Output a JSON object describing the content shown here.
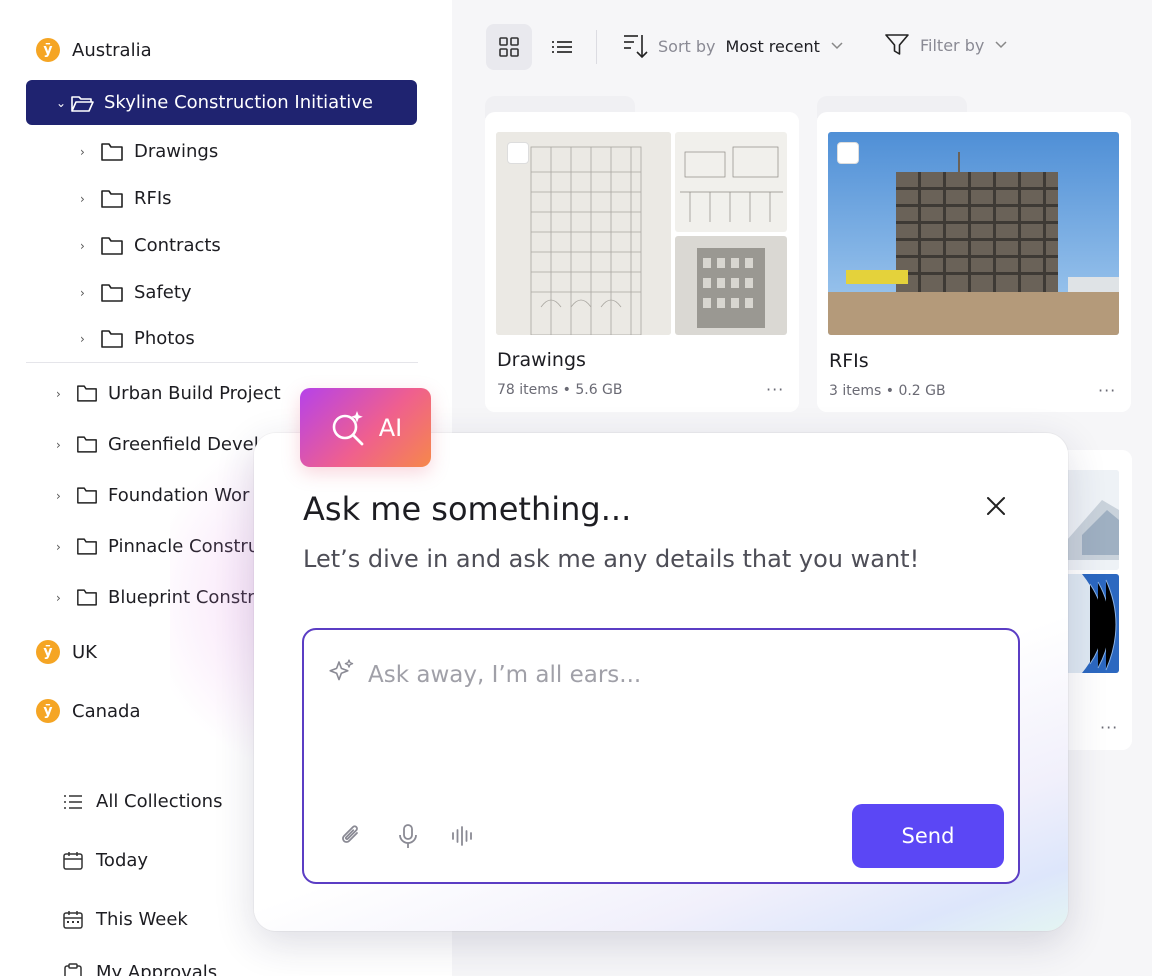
{
  "sidebar": {
    "regions": [
      {
        "label": "Australia"
      },
      {
        "label": "UK"
      },
      {
        "label": "Canada"
      }
    ],
    "active_project": "Skyline Construction Initiative",
    "subfolders": [
      {
        "label": "Drawings"
      },
      {
        "label": "RFIs"
      },
      {
        "label": "Contracts"
      },
      {
        "label": "Safety"
      },
      {
        "label": "Photos"
      }
    ],
    "projects": [
      {
        "label": "Urban Build Project"
      },
      {
        "label": "Greenfield Devel"
      },
      {
        "label": "Foundation Wor"
      },
      {
        "label": "Pinnacle Constru"
      },
      {
        "label": "Blueprint Constr"
      }
    ],
    "collections": [
      {
        "label": "All Collections",
        "icon": "list-icon"
      },
      {
        "label": "Today",
        "icon": "calendar-icon"
      },
      {
        "label": "This Week",
        "icon": "calendar-week-icon"
      },
      {
        "label": "My Approvals",
        "icon": "clipboard-icon"
      }
    ]
  },
  "toolbar": {
    "sort_label": "Sort by",
    "sort_value": "Most recent",
    "filter_label": "Filter by"
  },
  "cards": [
    {
      "title": "Drawings",
      "meta": "78 items • 5.6 GB",
      "more": "···"
    },
    {
      "title": "RFIs",
      "meta": "3 items • 0.2 GB",
      "more": "···"
    },
    {
      "more": "···"
    }
  ],
  "ai_modal": {
    "badge": "AI",
    "title": "Ask me something...",
    "subtitle": "Let’s dive in and ask me any details that you want!",
    "placeholder": "Ask away, I’m all ears...",
    "send_label": "Send"
  },
  "colors": {
    "accent": "#5b47f5",
    "active_nav": "#1f2370",
    "region_badge": "#f5a524"
  }
}
